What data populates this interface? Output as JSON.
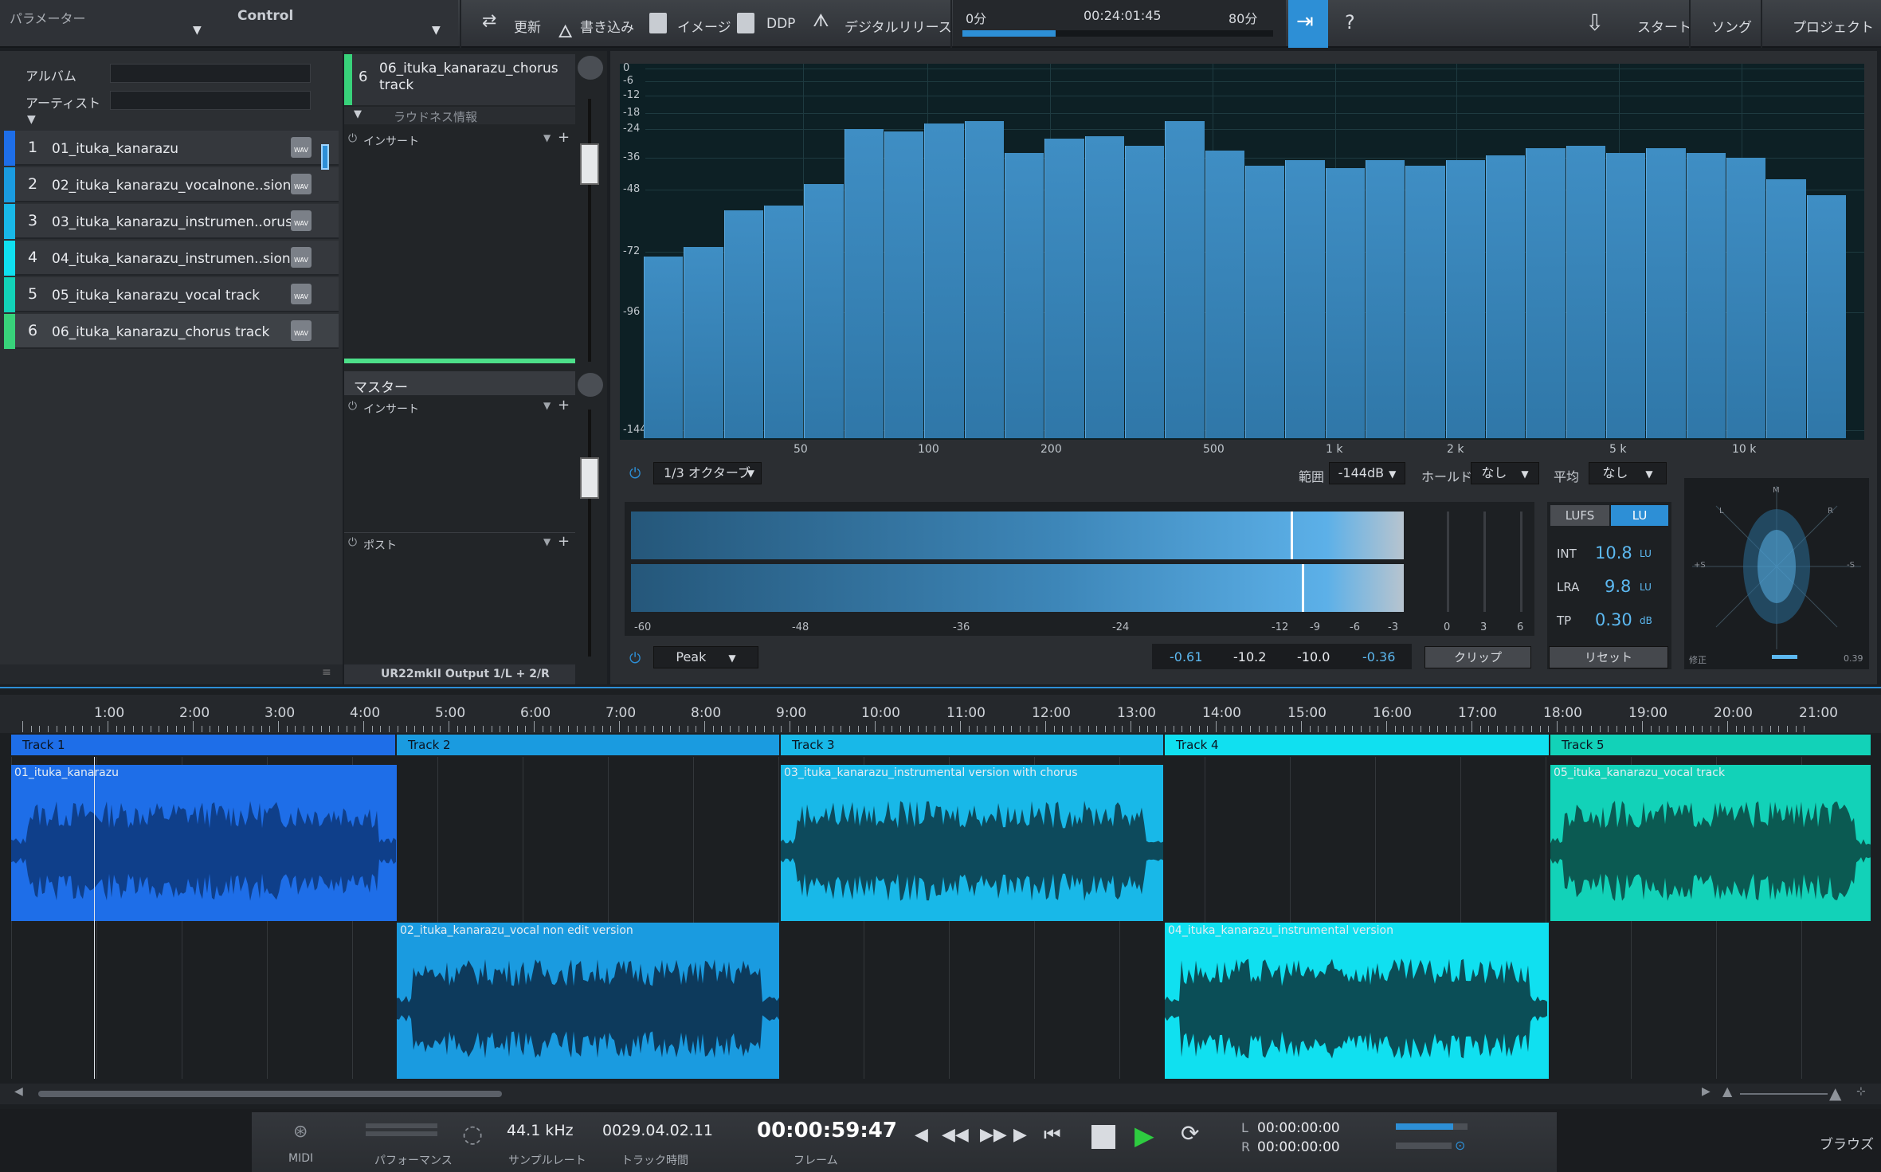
{
  "topbar": {
    "param_label": "パラメーター",
    "control_label": "Control",
    "update": "更新",
    "write": "書き込み",
    "image": "イメージ",
    "ddp": "DDP",
    "digital_release": "デジタルリリース",
    "time_start": "0分",
    "time_current": "00:24:01:45",
    "time_end": "80分",
    "progress": 0.3,
    "help": "?",
    "start": "スタート",
    "song": "ソング",
    "project": "プロジェクト"
  },
  "meta": {
    "album_label": "アルバム",
    "artist_label": "アーティスト"
  },
  "tracks": [
    {
      "num": "1",
      "name": "01_ituka_kanarazu",
      "color": "#1e6ee8"
    },
    {
      "num": "2",
      "name": "02_ituka_kanarazu_vocalnone..sion",
      "color": "#1a9be0"
    },
    {
      "num": "3",
      "name": "03_ituka_kanarazu_instrumen..orus",
      "color": "#18b8e8"
    },
    {
      "num": "4",
      "name": "04_ituka_kanarazu_instrumen..sion",
      "color": "#10e0f0"
    },
    {
      "num": "5",
      "name": "05_ituka_kanarazu_vocal track",
      "color": "#12d2b8"
    },
    {
      "num": "6",
      "name": "06_ituka_kanarazu_chorus track",
      "color": "#38d27a"
    }
  ],
  "wav_label": "WAV",
  "inserts": {
    "selected_num": "6",
    "selected_name": "06_ituka_kanarazu_chorus track",
    "loudness": "ラウドネス情報",
    "insert": "インサート",
    "master": "マスター",
    "insert2": "インサート",
    "post": "ポスト",
    "output": "UR22mkII Output 1/L + 2/R"
  },
  "spectrum": {
    "db_labels": [
      "0",
      "-6",
      "-12",
      "-18",
      "-24",
      "-36",
      "-48",
      "-72",
      "-96",
      "-144"
    ],
    "freq_labels": [
      "50",
      "100",
      "200",
      "500",
      "1 k",
      "2 k",
      "5 k",
      "10 k"
    ],
    "bars": [
      -74,
      -70,
      -56,
      -54,
      -46,
      -24,
      -25,
      -22,
      -21,
      -34,
      -28,
      -27,
      -31,
      -21,
      -33,
      -39,
      -37,
      -40,
      -37,
      -39,
      -37,
      -35,
      -32,
      -31,
      -34,
      -32,
      -34,
      -36,
      -44,
      -50
    ],
    "mode": "1/3 オクターブ",
    "range_label": "範囲",
    "range": "-144dB",
    "hold_label": "ホールド",
    "hold": "なし",
    "avg_label": "平均",
    "avg": "なし"
  },
  "meter": {
    "scale": [
      "-60",
      "-48",
      "-36",
      "-24",
      "-12",
      "-9",
      "-6",
      "-3",
      "0",
      "3",
      "6"
    ],
    "mode": "Peak",
    "v1": "-0.61",
    "v2": "-10.2",
    "v3": "-10.0",
    "v4": "-0.36",
    "clip": "クリップ"
  },
  "loudness": {
    "tab_lufs": "LUFS",
    "tab_lu": "LU",
    "int_label": "INT",
    "int": "10.8",
    "int_unit": "LU",
    "lra_label": "LRA",
    "lra": "9.8",
    "lra_unit": "LU",
    "tp_label": "TP",
    "tp": "0.30",
    "tp_unit": "dB",
    "reset": "リセット"
  },
  "scope": {
    "m": "M",
    "l": "L",
    "r": "R",
    "sl": "+S",
    "sr": "-S",
    "corr": "修正",
    "val": "0.39"
  },
  "timeline": {
    "ticks": [
      "1:00",
      "2:00",
      "3:00",
      "4:00",
      "5:00",
      "6:00",
      "7:00",
      "8:00",
      "9:00",
      "10:00",
      "11:00",
      "12:00",
      "13:00",
      "14:00",
      "15:00",
      "16:00",
      "17:00",
      "18:00",
      "19:00",
      "20:00",
      "21:00"
    ],
    "tracks": [
      "Track 1",
      "Track 2",
      "Track 3",
      "Track 4",
      "Track 5"
    ],
    "clips": [
      "01_ituka_kanarazu",
      "02_ituka_kanarazu_vocal non edit version",
      "03_ituka_kanarazu_instrumental version with chorus",
      "04_ituka_kanarazu_instrumental version",
      "05_ituka_kanarazu_vocal track"
    ]
  },
  "transport": {
    "midi": "MIDI",
    "perf": "パフォーマンス",
    "rate": "44.1 kHz",
    "rate_label": "サンプルレート",
    "track_time": "0029.04.02.11",
    "track_time_label": "トラック時間",
    "time": "00:00:59:47",
    "frame_label": "フレーム",
    "l": "L",
    "r": "R",
    "l_time": "00:00:00:00",
    "r_time": "00:00:00:00",
    "browse": "ブラウズ"
  },
  "colors": {
    "accent": "#2d8fd6",
    "bg": "#1b1e22"
  }
}
